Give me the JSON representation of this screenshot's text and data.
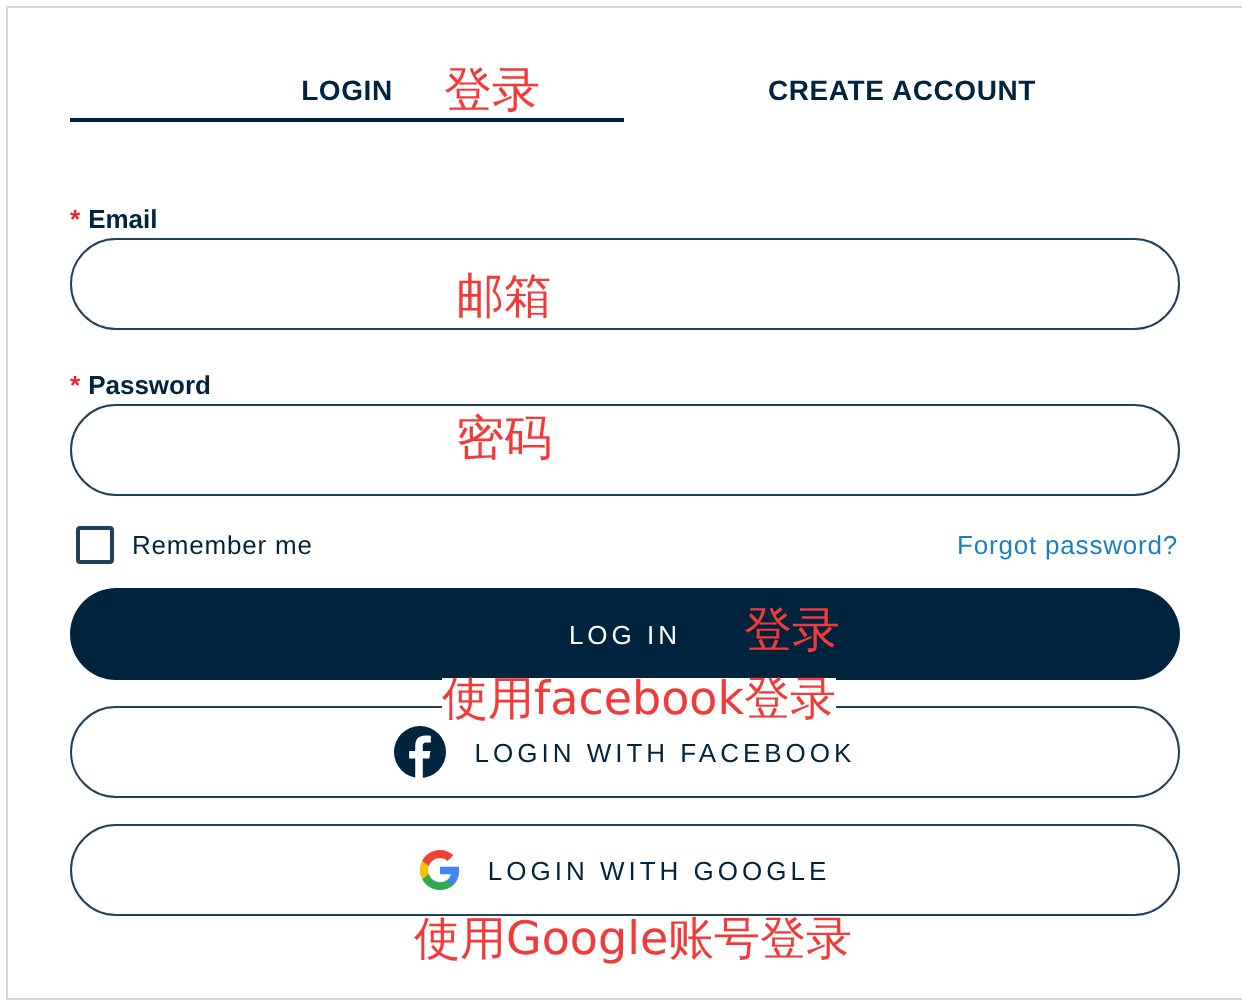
{
  "tabs": [
    {
      "label": "LOGIN",
      "selected": true
    },
    {
      "label": "CREATE ACCOUNT",
      "selected": false
    }
  ],
  "fields": [
    {
      "label": "Email",
      "required_mark": "*"
    },
    {
      "label": "Password",
      "required_mark": "*"
    }
  ],
  "remember": {
    "label": "Remember me",
    "checked": false
  },
  "forgot_link": "Forgot password?",
  "buttons": [
    {
      "kind": "primary",
      "label": "LOG IN"
    },
    {
      "kind": "facebook",
      "label": "LOGIN WITH FACEBOOK"
    },
    {
      "kind": "google",
      "label": "LOGIN WITH GOOGLE"
    }
  ],
  "annotations": [
    "登录",
    "邮箱",
    "密码",
    "登录",
    "使用facebook登录",
    "使用Google账号登录"
  ]
}
